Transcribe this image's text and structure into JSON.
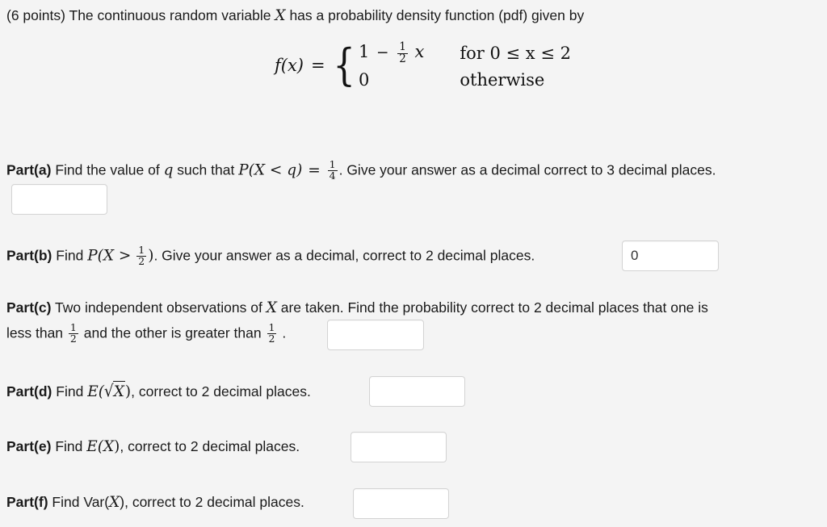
{
  "page": {
    "background_color": "#f4f4f4",
    "text_color": "#1a1a1a",
    "input_border_color": "#d3d3d3",
    "input_background": "#ffffff"
  },
  "header": {
    "points": "(6 points)",
    "text_before_var": "The continuous random variable",
    "variable": "X",
    "text_after_var": "has a probability density function (pdf) given by"
  },
  "formula": {
    "lhs": "f(x)",
    "equals": "=",
    "case1_expression_lead": "1",
    "case1_minus": "−",
    "case1_fraction_num": "1",
    "case1_fraction_den": "2",
    "case1_variable": "x",
    "case1_condition": "for 0 ≤ x ≤ 2",
    "case2_expression": "0",
    "case2_condition": "otherwise"
  },
  "parts": {
    "a": {
      "label": "Part(a)",
      "text1": "Find the value of",
      "var_q": "q",
      "text2": "such that",
      "probability": "P(X < q)",
      "equals": "=",
      "frac_num": "1",
      "frac_den": "4",
      "text3": ". Give your answer as a decimal correct to 3 decimal places.",
      "answer_value": "",
      "answer_placeholder": ""
    },
    "b": {
      "label": "Part(b)",
      "text1": "Find",
      "prob_open": "P(X >",
      "frac_num": "1",
      "frac_den": "2",
      "prob_close": ")",
      "text2": ". Give your answer as a decimal, correct to 2 decimal places.",
      "answer_value": "0",
      "answer_placeholder": ""
    },
    "c": {
      "label": "Part(c)",
      "line1_text1": "Two independent observations of",
      "line1_variable": "X",
      "line1_text2": "are taken. Find the probability correct to 2 decimal places that one is",
      "line2_text1": "less than",
      "line2_frac1_num": "1",
      "line2_frac1_den": "2",
      "line2_text2": "and the other is greater than",
      "line2_frac2_num": "1",
      "line2_frac2_den": "2",
      "line2_text3": ".",
      "answer_value": "",
      "answer_placeholder": ""
    },
    "d": {
      "label": "Part(d)",
      "text1": "Find",
      "expr_lead": "E(",
      "expr_radical": "√",
      "expr_radicand": "X",
      "expr_close": ")",
      "text2": ", correct to 2 decimal places.",
      "answer_value": "",
      "answer_placeholder": ""
    },
    "e": {
      "label": "Part(e)",
      "text1": "Find",
      "expr_lead": "E(",
      "expr_variable": "X",
      "expr_close": ")",
      "text2": ", correct to 2 decimal places.",
      "answer_value": "",
      "answer_placeholder": ""
    },
    "f": {
      "label": "Part(f)",
      "text1": "Find",
      "expr_lead": "Var(",
      "expr_variable": "X",
      "expr_close": ")",
      "text2": ", correct to 2 decimal places.",
      "answer_value": "",
      "answer_placeholder": ""
    }
  }
}
